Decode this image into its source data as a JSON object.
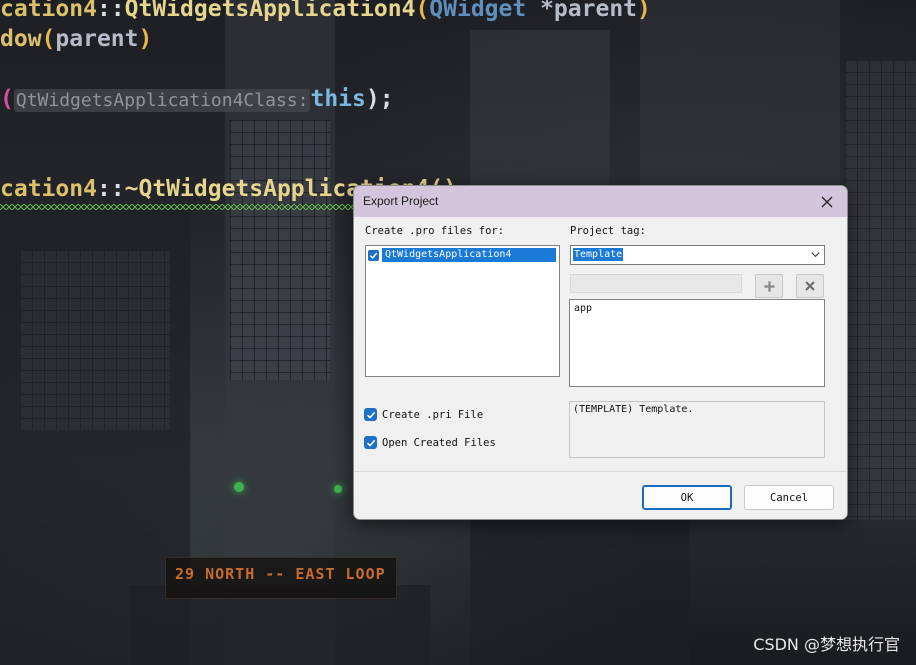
{
  "editor": {
    "line1_class": "cation4",
    "line1_scope": "::",
    "line1_ctor": "QtWidgetsApplication4",
    "line1_open": "(",
    "line1_type": "QWidget",
    "line1_param": " *parent",
    "line1_close": ")",
    "line2_base": "dow",
    "line2_open": "(",
    "line2_arg": "parent",
    "line2_close": ")",
    "line3_open": "(",
    "line3_hint": "QtWidgetsApplication4Class:",
    "line3_this": "this",
    "line3_close": ");",
    "line4_class": "cation4",
    "line4_scope": "::",
    "line4_dtor": "~QtWidgetsApplication4()"
  },
  "background": {
    "sign_text": "29  NORTH -- EAST LOOP"
  },
  "watermark": "CSDN @梦想执行官",
  "dialog": {
    "title": "Export Project",
    "close_icon": "close-icon",
    "left_label": "Create .pro files for:",
    "projects": [
      {
        "name": "QtWidgetsApplication4",
        "checked": true
      }
    ],
    "tag_label": "Project tag:",
    "tag_selected": "Template",
    "tag_input_value": "",
    "add_icon": "plus-icon",
    "remove_icon": "x-icon",
    "values": [
      "app"
    ],
    "create_pri_label": "Create .pri File",
    "create_pri_checked": true,
    "open_files_label": "Open Created Files",
    "open_files_checked": true,
    "description": "(TEMPLATE) Template.",
    "ok_label": "OK",
    "cancel_label": "Cancel"
  },
  "colors": {
    "titlebar": "#d3c6dc",
    "accent": "#1a7ad6",
    "dialog_bg": "#f0f0f0"
  }
}
